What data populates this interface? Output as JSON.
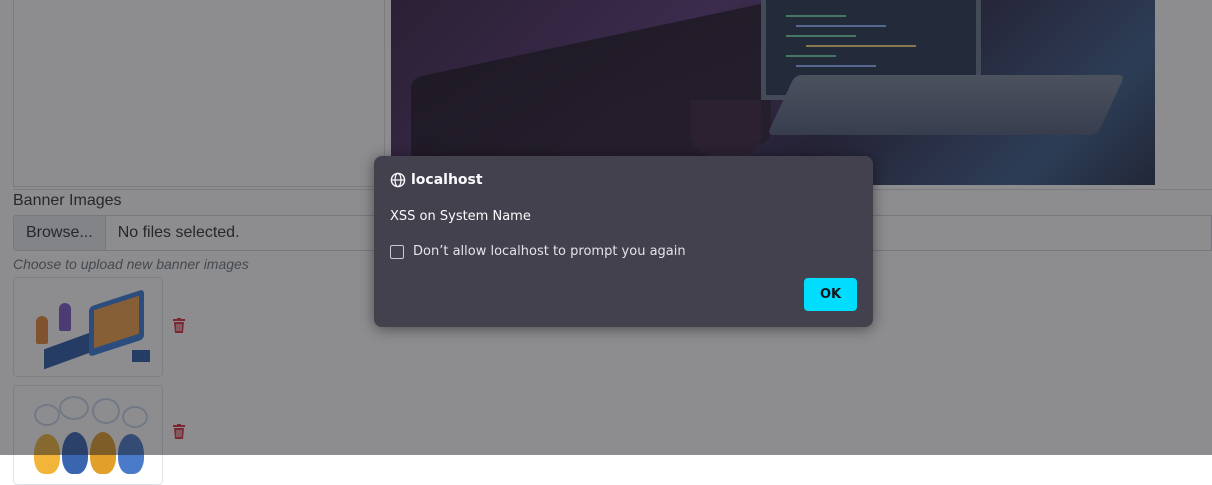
{
  "form": {
    "banner_label": "Banner Images",
    "browse_label": "Browse...",
    "file_status": "No files selected.",
    "help_text": "Choose to upload new banner images"
  },
  "dialog": {
    "origin": "localhost",
    "message": "XSS on System Name",
    "checkbox_label": "Don’t allow localhost to prompt you again",
    "checkbox_checked": false,
    "ok_label": "OK"
  },
  "icons": {
    "globe": "globe-icon",
    "trash": "trash-icon"
  },
  "colors": {
    "ok_button": "#00ddff",
    "dialog_bg": "#42414d",
    "trash": "#dc3545"
  }
}
